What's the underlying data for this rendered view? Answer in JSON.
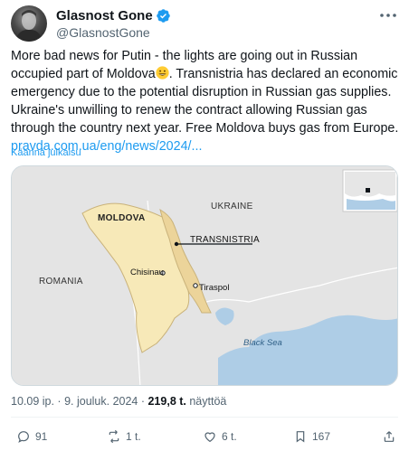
{
  "author": {
    "display_name": "Glasnost Gone",
    "handle": "@GlasnostGone",
    "verified_color": "#1d9bf0"
  },
  "tweet": {
    "text_before_emoji": "More bad news for Putin - the lights are going out in Russian occupied part of Moldova",
    "text_after_emoji": ". Transnistria has declared an economic emergency due to the potential disruption in Russian gas supplies. Ukraine's unwilling to renew the contract allowing Russian gas through the country next year. Free Moldova buys gas from Europe.",
    "link": "pravda.com.ua/eng/​news/2024/...",
    "translate_label": "Käännä julkaisu"
  },
  "map": {
    "labels": {
      "moldova": "MOLDOVA",
      "ukraine": "UKRAINE",
      "transnistria": "TRANSNISTRIA",
      "chisinau": "Chisinau",
      "tiraspol": "Tiraspol",
      "romania": "ROMANIA",
      "black_sea": "Black Sea"
    }
  },
  "meta": {
    "time_date": "10.09 ip. · 9. jouluk. 2024 · ",
    "views_count": "219,8 t.",
    "views_label": " näyttöä"
  },
  "actions": {
    "replies": "91",
    "reposts": "1 t.",
    "likes": "6 t.",
    "bookmarks": "167"
  },
  "colors": {
    "moldova_fill": "#f7e9b8",
    "transnistria_fill": "#ecd49a",
    "sea": "#aecde6",
    "land": "#e4e4e4",
    "link": "#1d9bf0"
  }
}
